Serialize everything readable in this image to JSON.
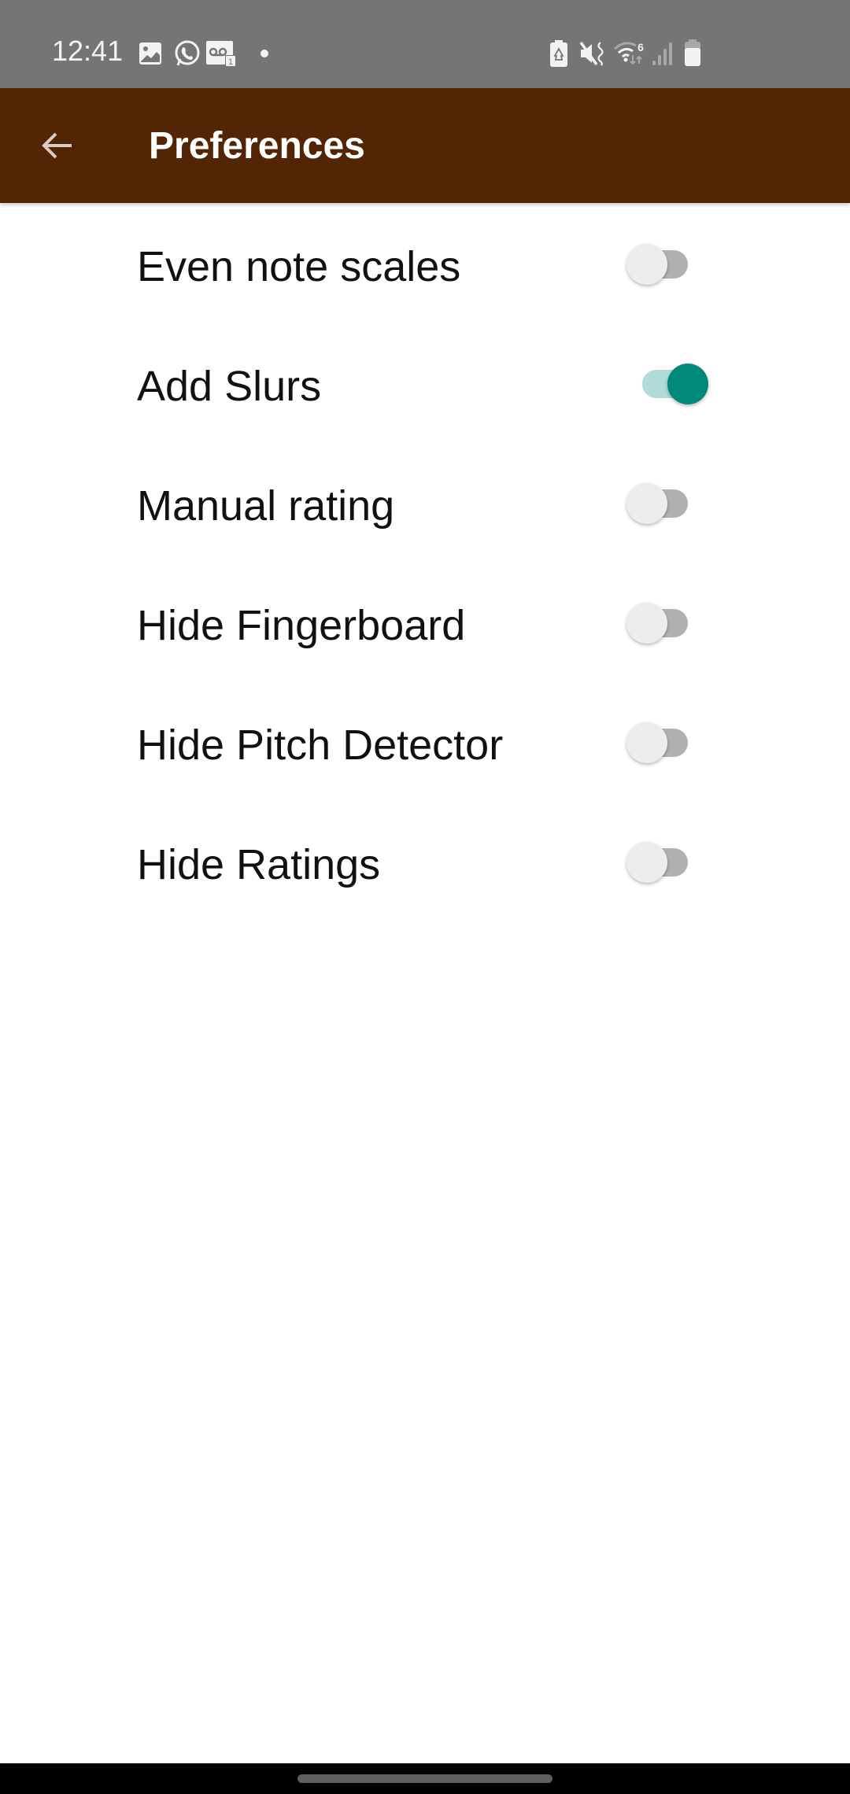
{
  "status_bar": {
    "time": "12:41",
    "left_icons": [
      "gallery-icon",
      "whatsapp-icon",
      "voicemail-icon",
      "more-notifications-dot"
    ],
    "voicemail_count": "1",
    "right_icons": [
      "battery-saver-icon",
      "mute-vibrate-icon",
      "wifi-6-icon",
      "signal-icon",
      "battery-icon"
    ],
    "wifi_label": "6"
  },
  "app_bar": {
    "title": "Preferences",
    "back_icon": "arrow-back-icon",
    "background": "#522504"
  },
  "preferences": [
    {
      "label": "Even note scales",
      "enabled": false
    },
    {
      "label": "Add Slurs",
      "enabled": true
    },
    {
      "label": "Manual rating",
      "enabled": false
    },
    {
      "label": "Hide Fingerboard",
      "enabled": false
    },
    {
      "label": "Hide Pitch Detector",
      "enabled": false
    },
    {
      "label": "Hide Ratings",
      "enabled": false
    }
  ],
  "colors": {
    "switch_on": "#00897b",
    "switch_on_track": "#afdcd8",
    "switch_off_thumb": "#ececec",
    "switch_off_track": "#b0b0b0"
  }
}
